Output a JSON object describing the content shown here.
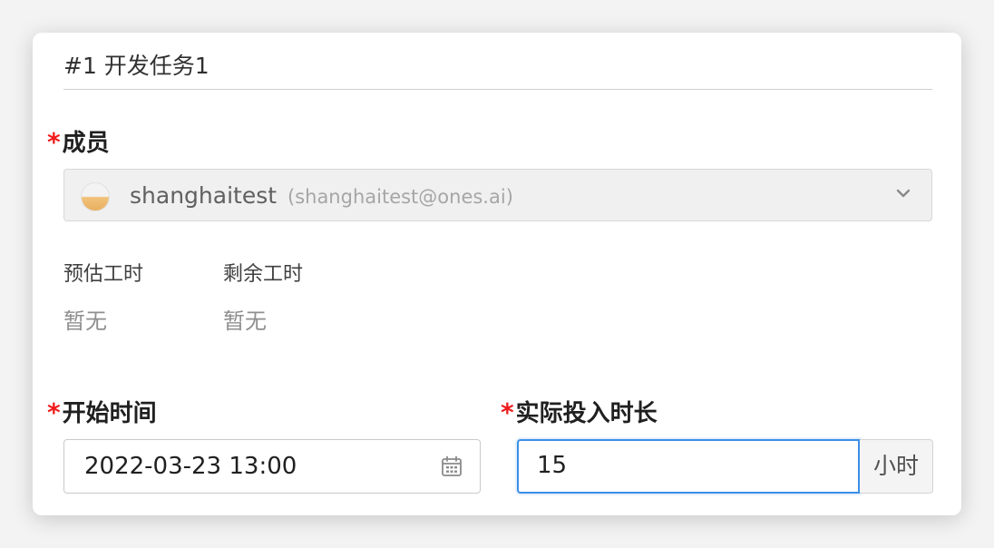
{
  "task": {
    "title": "#1 开发任务1"
  },
  "member": {
    "label": "成员",
    "required_mark": "*",
    "selected_name": "shanghaitest",
    "selected_email": "(shanghaitest@ones.ai)",
    "icon": "chevron-down-icon"
  },
  "hours": {
    "estimated_label": "预估工时",
    "estimated_value": "暂无",
    "remaining_label": "剩余工时",
    "remaining_value": "暂无"
  },
  "start_time": {
    "label": "开始时间",
    "required_mark": "*",
    "value": "2022-03-23 13:00",
    "icon": "calendar-icon"
  },
  "duration": {
    "label": "实际投入时长",
    "required_mark": "*",
    "value": "15",
    "unit": "小时"
  },
  "colors": {
    "required": "#f01b1b",
    "focus_border": "#3b8fe8"
  }
}
